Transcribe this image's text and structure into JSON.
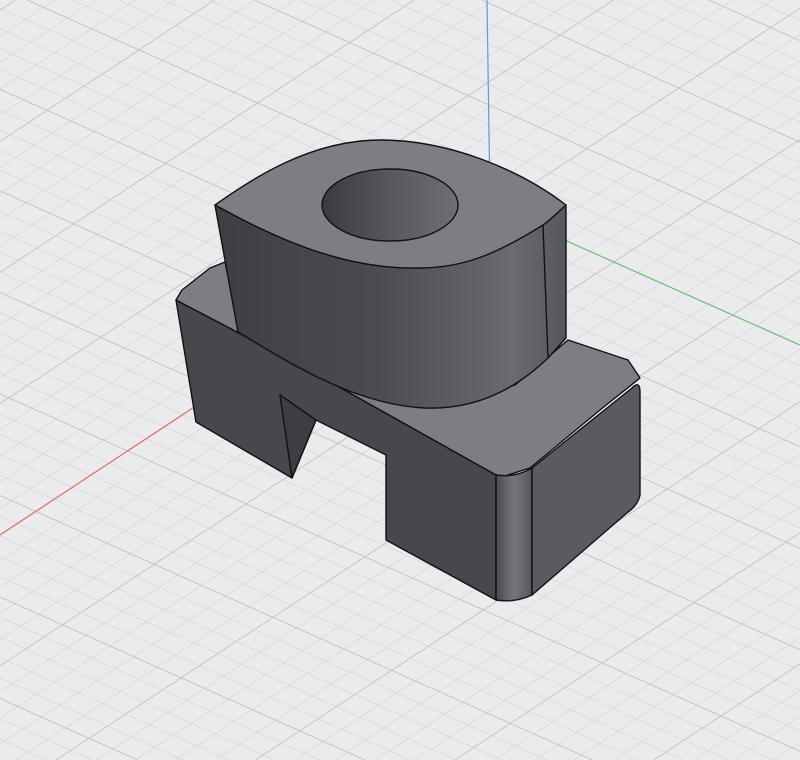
{
  "viewport": {
    "background": "#ebebee",
    "grid_minor_color": "#d6d6da",
    "grid_major_color": "#c4c4c9"
  },
  "axes": {
    "x_color": "#e0706a",
    "y_color": "#6cc07a",
    "z_color": "#5a9be6"
  },
  "model": {
    "top_color": "#7d7e84",
    "side_dark_color": "#47484c",
    "side_mid_color": "#5a5b60",
    "edge_color": "#111114"
  }
}
